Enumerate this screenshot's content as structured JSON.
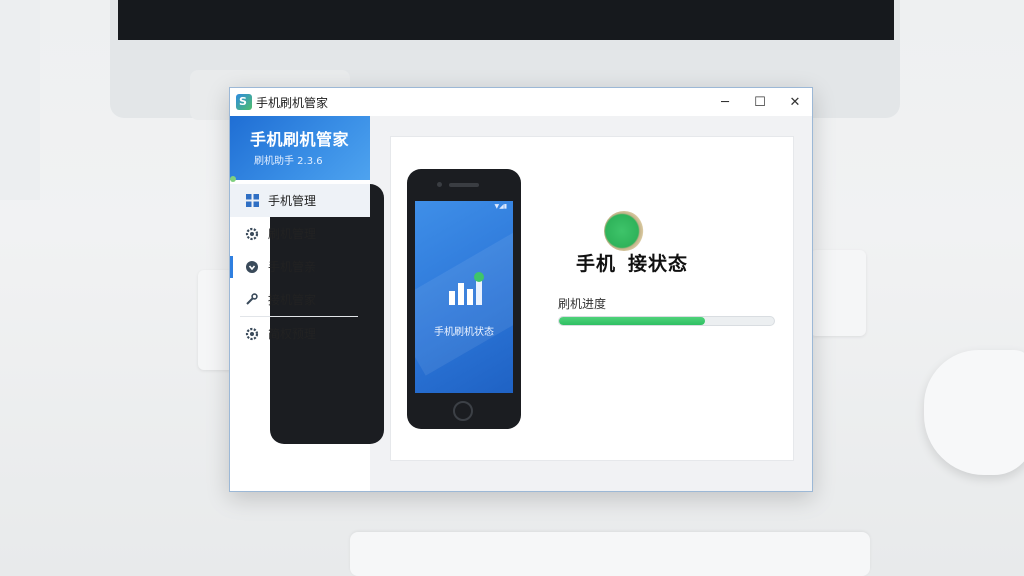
{
  "window": {
    "title": "手机刷机管家",
    "controls": {
      "minimize": "─",
      "maximize": "☐",
      "close": "✕"
    }
  },
  "sidebar": {
    "brand_title": "手机刷机管家",
    "brand_subtitle": "刷机助手 2.3.6",
    "items": [
      {
        "label": "手机管理",
        "icon": "grid-icon"
      },
      {
        "label": "刷机管理",
        "icon": "gear-icon"
      },
      {
        "label": "手机管亲",
        "icon": "shield-icon"
      },
      {
        "label": "接机管家",
        "icon": "wrench-icon"
      },
      {
        "label": "简权预理",
        "icon": "settings-icon"
      }
    ]
  },
  "main": {
    "phone_screen_caption": "手机刷机状态",
    "status_part1": "手机",
    "status_part2": "接状态",
    "progress_label": "刷机进度",
    "progress_value": 0.68
  },
  "colors": {
    "accent": "#2f7fe0",
    "progress": "#2fbf62"
  }
}
